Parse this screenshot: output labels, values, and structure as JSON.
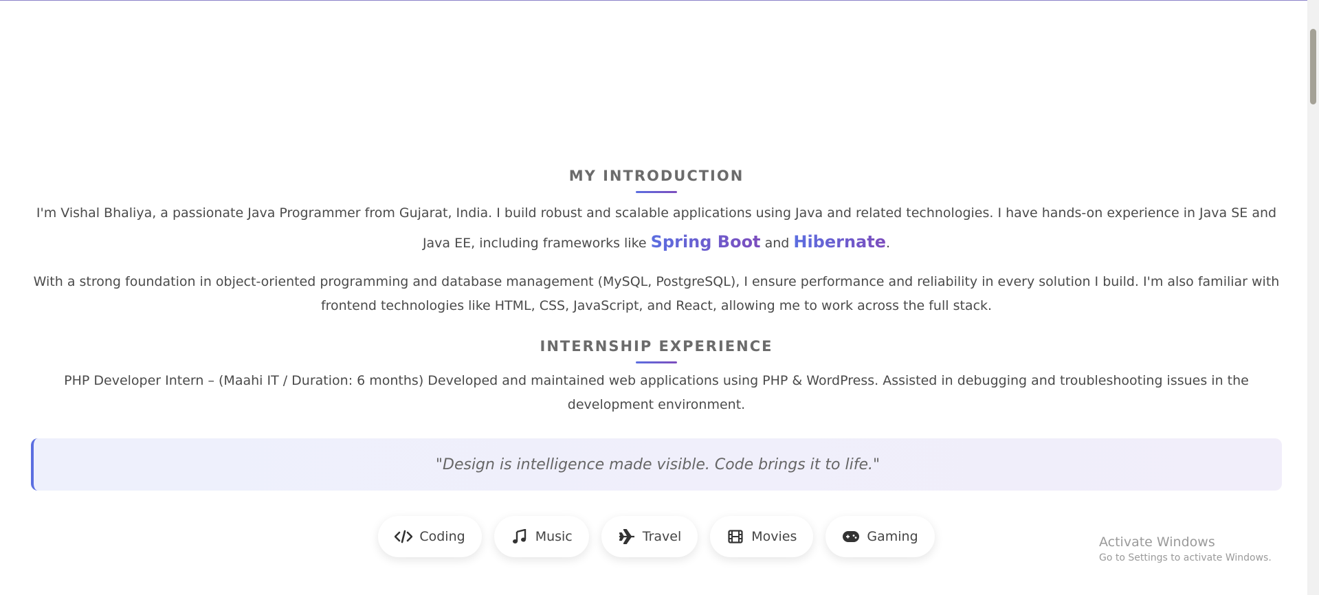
{
  "intro": {
    "title": "MY INTRODUCTION",
    "p1_a": "I'm Vishal Bhaliya, a passionate Java Programmer from Gujarat, India. I build robust and scalable applications using Java and related technologies. I have hands-on experience in Java SE and Java EE, including frameworks like ",
    "highlight_1": "Spring Boot",
    "p1_and": " and ",
    "highlight_2": "Hibernate",
    "p1_end": ".",
    "p2": "With a strong foundation in object-oriented programming and database management (MySQL, PostgreSQL), I ensure performance and reliability in every solution I build. I'm also familiar with frontend technologies like HTML, CSS, JavaScript, and React, allowing me to work across the full stack."
  },
  "internship": {
    "title": "INTERNSHIP EXPERIENCE",
    "text": "PHP Developer Intern – (Maahi IT / Duration: 6 months) Developed and maintained web applications using PHP & WordPress. Assisted in debugging and troubleshooting issues in the development environment."
  },
  "quote": "\"Design is intelligence made visible. Code brings it to life.\"",
  "hobbies": [
    {
      "label": "Coding",
      "icon": "code-icon"
    },
    {
      "label": "Music",
      "icon": "music-note-icon"
    },
    {
      "label": "Travel",
      "icon": "airplane-icon"
    },
    {
      "label": "Movies",
      "icon": "film-icon"
    },
    {
      "label": "Gaming",
      "icon": "gamepad-icon"
    }
  ],
  "watermark": {
    "line1": "Activate Windows",
    "line2": "Go to Settings to activate Windows."
  },
  "colors": {
    "accent_start": "#5b6ee0",
    "accent_end": "#7c4dbd"
  }
}
